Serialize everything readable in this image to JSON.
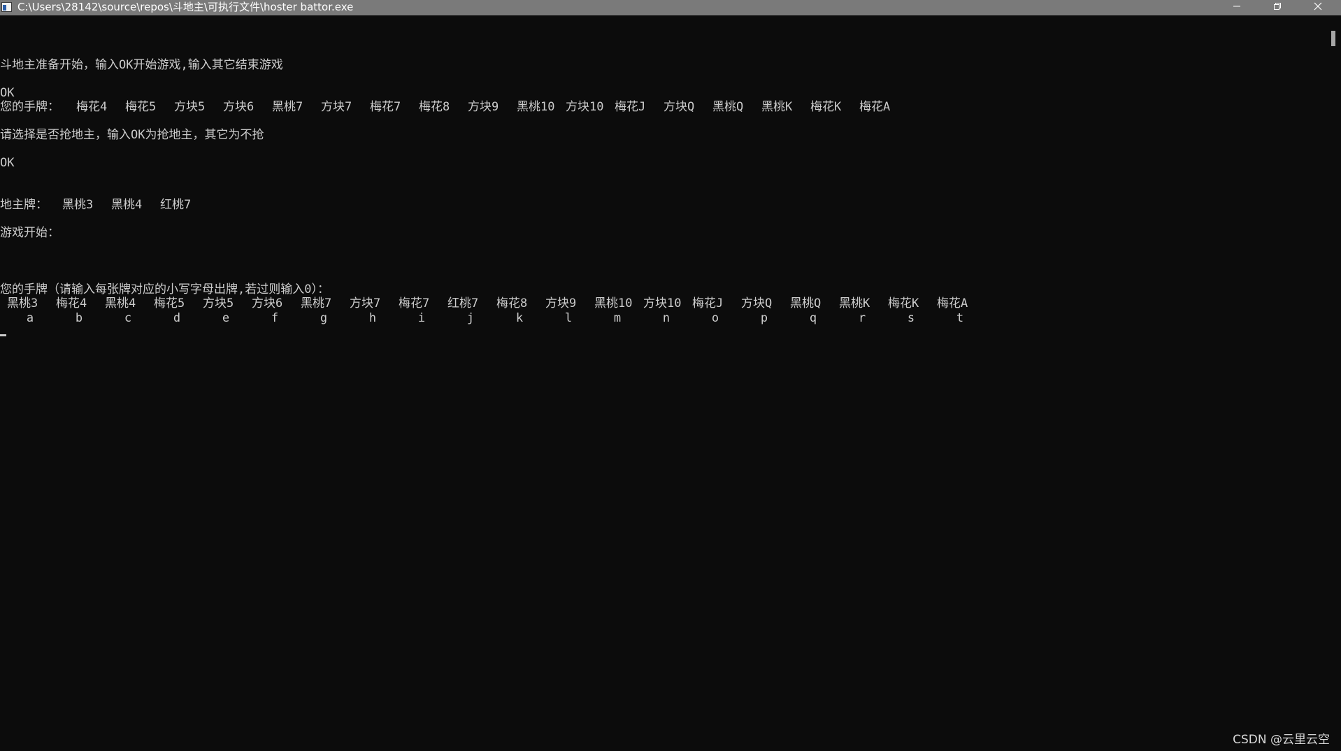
{
  "window": {
    "title": "C:\\Users\\28142\\source\\repos\\斗地主\\可执行文件\\hoster battor.exe",
    "icon": "console-app-icon",
    "controls": {
      "minimize": "minimize-icon",
      "restore": "restore-icon",
      "close": "close-icon"
    }
  },
  "console": {
    "start_prompt": "斗地主准备开始，输入OK开始游戏,输入其它结束游戏",
    "input_ok_1": "OK",
    "hand_label": "您的手牌：",
    "hand_cards": [
      "梅花4",
      "梅花5",
      "方块5",
      "方块6",
      "黑桃7",
      "方块7",
      "梅花7",
      "梅花8",
      "方块9",
      "黑桃10",
      "方块10",
      "梅花J",
      "方块Q",
      "黑桃Q",
      "黑桃K",
      "梅花K",
      "梅花A"
    ],
    "grab_prompt": "请选择是否抢地主，输入OK为抢地主，其它为不抢",
    "input_ok_2": "OK",
    "landlord_label": "地主牌：",
    "landlord_cards": [
      "黑桃3",
      "黑桃4",
      "红桃7"
    ],
    "game_start": "游戏开始：",
    "play_prompt": "您的手牌（请输入每张牌对应的小写字母出牌,若过则输入0）：",
    "play_cards": [
      "黑桃3",
      "梅花4",
      "黑桃4",
      "梅花5",
      "方块5",
      "方块6",
      "黑桃7",
      "方块7",
      "梅花7",
      "红桃7",
      "梅花8",
      "方块9",
      "黑桃10",
      "方块10",
      "梅花J",
      "方块Q",
      "黑桃Q",
      "黑桃K",
      "梅花K",
      "梅花A"
    ],
    "play_keys": [
      "a",
      "b",
      "c",
      "d",
      "e",
      "f",
      "g",
      "h",
      "i",
      "j",
      "k",
      "l",
      "m",
      "n",
      "o",
      "p",
      "q",
      "r",
      "s",
      "t"
    ]
  },
  "watermark": "CSDN @云里云空",
  "colors": {
    "background": "#0c0c0c",
    "text": "#cccccc",
    "titlebar": "#7a7a7a"
  }
}
